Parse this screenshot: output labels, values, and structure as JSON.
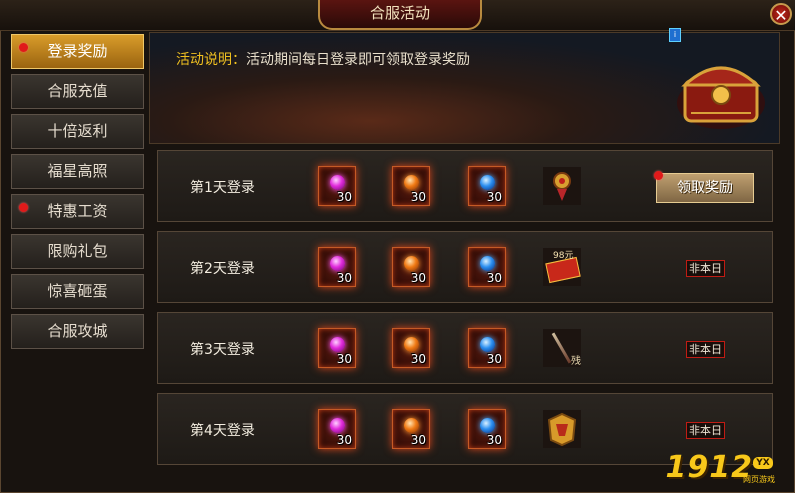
{
  "window": {
    "title": "合服活动",
    "close_icon": "close-icon"
  },
  "sidebar": {
    "items": [
      {
        "label": "登录奖励",
        "active": true,
        "badge": true
      },
      {
        "label": "合服充值",
        "active": false,
        "badge": false
      },
      {
        "label": "十倍返利",
        "active": false,
        "badge": false
      },
      {
        "label": "福星高照",
        "active": false,
        "badge": false
      },
      {
        "label": "特惠工资",
        "active": false,
        "badge": true
      },
      {
        "label": "限购礼包",
        "active": false,
        "badge": false
      },
      {
        "label": "惊喜砸蛋",
        "active": false,
        "badge": false
      },
      {
        "label": "合服攻城",
        "active": false,
        "badge": false
      }
    ]
  },
  "banner": {
    "desc_label": "活动说明：",
    "desc_text": "活动期间每日登录即可领取登录奖励",
    "image_icon": "treasure-chest-icon"
  },
  "rows": [
    {
      "label": "第1天登录",
      "items": [
        {
          "gem": "pink",
          "qty": "30"
        },
        {
          "gem": "orange",
          "qty": "30"
        },
        {
          "gem": "blue",
          "qty": "30"
        }
      ],
      "reward_icon": "golden-amulet-icon",
      "action": "领取奖励",
      "action_type": "button"
    },
    {
      "label": "第2天登录",
      "items": [
        {
          "gem": "pink",
          "qty": "30"
        },
        {
          "gem": "orange",
          "qty": "30"
        },
        {
          "gem": "blue",
          "qty": "30"
        }
      ],
      "reward_icon": "red-packet-icon",
      "reward_text": "98元",
      "action": "非本日",
      "action_type": "status"
    },
    {
      "label": "第3天登录",
      "items": [
        {
          "gem": "pink",
          "qty": "30"
        },
        {
          "gem": "orange",
          "qty": "30"
        },
        {
          "gem": "blue",
          "qty": "30"
        }
      ],
      "reward_icon": "weapon-staff-icon",
      "reward_text": "残",
      "action": "非本日",
      "action_type": "status"
    },
    {
      "label": "第4天登录",
      "items": [
        {
          "gem": "pink",
          "qty": "30"
        },
        {
          "gem": "orange",
          "qty": "30"
        },
        {
          "gem": "blue",
          "qty": "30"
        }
      ],
      "reward_icon": "golden-armor-icon",
      "action": "非本日",
      "action_type": "status"
    }
  ],
  "watermark": {
    "number": "1912",
    "badge": "YX",
    "sub": "网页游戏"
  },
  "colors": {
    "accent": "#d99c2a",
    "status_border": "#c01c14",
    "badge": "#e01a1a"
  }
}
